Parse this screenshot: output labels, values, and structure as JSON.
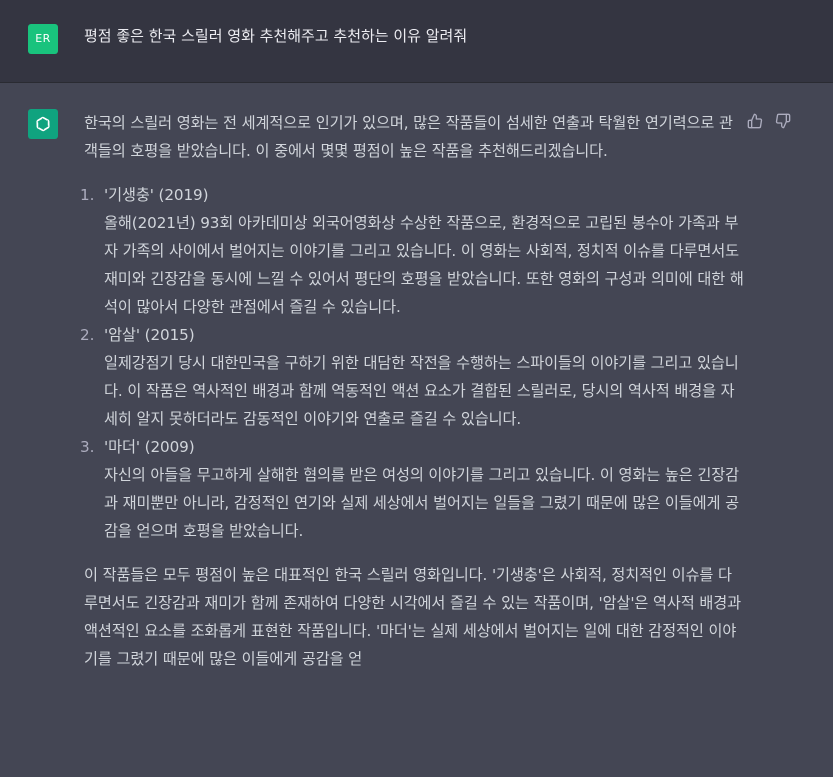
{
  "user": {
    "avatar_initials": "ER",
    "message": "평점 좋은 한국 스릴러 영화 추천해주고 추천하는 이유 알려줘"
  },
  "assistant": {
    "intro": "한국의 스릴러 영화는 전 세계적으로 인기가 있으며, 많은 작품들이 섬세한 연출과 탁월한 연기력으로 관객들의 호평을 받았습니다. 이 중에서 몇몇 평점이 높은 작품을 추천해드리겠습니다.",
    "items": [
      {
        "number": "1.",
        "title": "'기생충' (2019)",
        "description": "올해(2021년) 93회 아카데미상 외국어영화상 수상한 작품으로, 환경적으로 고립된 봉수아 가족과 부자 가족의 사이에서 벌어지는 이야기를 그리고 있습니다. 이 영화는 사회적, 정치적 이슈를 다루면서도 재미와 긴장감을 동시에 느낄 수 있어서 평단의 호평을 받았습니다. 또한 영화의 구성과 의미에 대한 해석이 많아서 다양한 관점에서 즐길 수 있습니다."
      },
      {
        "number": "2.",
        "title": "'암살' (2015)",
        "description": "일제강점기 당시 대한민국을 구하기 위한 대담한 작전을 수행하는 스파이들의 이야기를 그리고 있습니다. 이 작품은 역사적인 배경과 함께 역동적인 액션 요소가 결합된 스릴러로, 당시의 역사적 배경을 자세히 알지 못하더라도 감동적인 이야기와 연출로 즐길 수 있습니다."
      },
      {
        "number": "3.",
        "title": "'마더' (2009)",
        "description": "자신의 아들을 무고하게 살해한 혐의를 받은 여성의 이야기를 그리고 있습니다. 이 영화는 높은 긴장감과 재미뿐만 아니라, 감정적인 연기와 실제 세상에서 벌어지는 일들을 그렸기 때문에 많은 이들에게 공감을 얻으며 호평을 받았습니다."
      }
    ],
    "summary": "이 작품들은 모두 평점이 높은 대표적인 한국 스릴러 영화입니다. '기생충'은 사회적, 정치적인 이슈를 다루면서도 긴장감과 재미가 함께 존재하여 다양한 시각에서 즐길 수 있는 작품이며, '암살'은 역사적 배경과 액션적인 요소를 조화롭게 표현한 작품입니다. '마더'는 실제 세상에서 벌어지는 일에 대한 감정적인 이야기를 그렸기 때문에 많은 이들에게 공감을 얻"
  },
  "colors": {
    "user_bg": "#343541",
    "assistant_bg": "#444654",
    "user_avatar": "#19c37d",
    "gpt_avatar": "#10a37f",
    "text": "#d1d5db"
  },
  "icons": {
    "assistant_avatar": "openai-logo-icon",
    "like": "thumbs-up-icon",
    "dislike": "thumbs-down-icon"
  }
}
